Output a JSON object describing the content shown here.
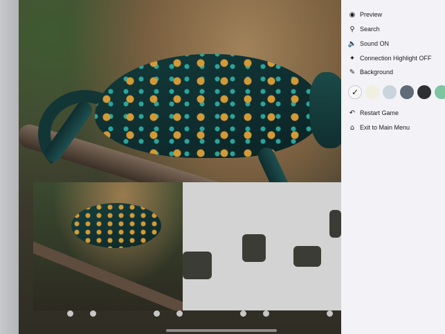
{
  "menu": {
    "preview": {
      "label": "Preview",
      "icon": "eye-icon"
    },
    "search": {
      "label": "Search",
      "icon": "search-icon"
    },
    "sound": {
      "label": "Sound ON",
      "icon": "speaker-icon"
    },
    "connection": {
      "label": "Connection Highlight OFF",
      "icon": "sparkle-icon"
    },
    "background": {
      "label": "Background",
      "icon": "paintbrush-icon"
    },
    "restart": {
      "label": "Restart Game",
      "icon": "undo-icon"
    },
    "exit": {
      "label": "Exit to Main Menu",
      "icon": "home-icon"
    }
  },
  "background_colors": [
    "#f7f7f7",
    "#f1efdf",
    "#c9d4dd",
    "#5f6b76",
    "#2e2f31",
    "#7dc4a0"
  ],
  "selected_background": 0
}
